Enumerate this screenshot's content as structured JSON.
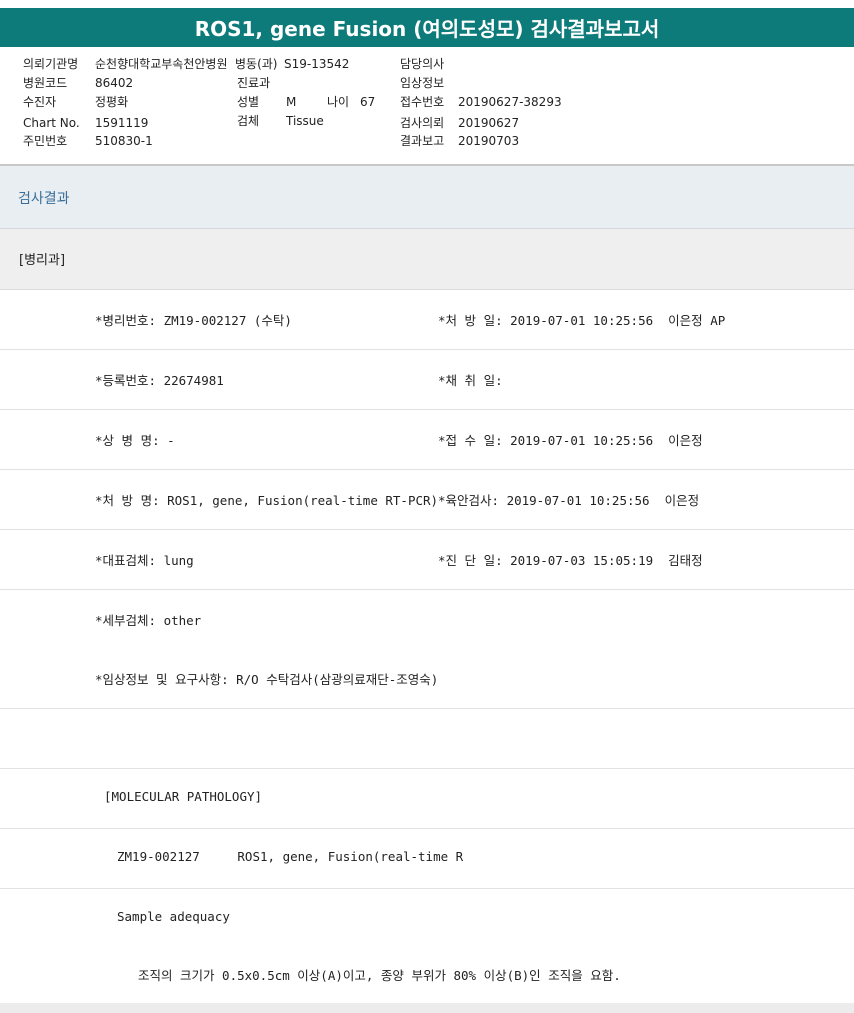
{
  "title": "ROS1, gene Fusion (여의도성모) 검사결과보고서",
  "header": {
    "req_org_label": "의뢰기관명",
    "req_org_value": "순천향대학교부속천안병원",
    "dept_label": "병동(과)",
    "dept_value": "S19-13542",
    "doctor_label": "담당의사",
    "hosp_code_label": "병원코드",
    "hosp_code_value": "86402",
    "clinic_label": "진료과",
    "clinical_info_label": "임상정보",
    "patient_label": "수진자",
    "patient_value": "정평화",
    "sex_label": "성별",
    "sex_value": "M",
    "age_label": "나이",
    "age_value": "67",
    "receipt_label": "접수번호",
    "receipt_value": "20190627-38293",
    "chart_label": "Chart No.",
    "chart_value": "1591119",
    "specimen_label": "검체",
    "specimen_value": "Tissue",
    "test_req_label": "검사의뢰",
    "test_req_value": "20190627",
    "rrn_label": "주민번호",
    "rrn_value": "510830-1",
    "report_label": "결과보고",
    "report_value": "20190703"
  },
  "section_title": "검사결과",
  "department": "[병리과]",
  "rows": [
    {
      "left": "*병리번호: ZM19-002127 (수탁)",
      "right": "*처 방 일: 2019-07-01 10:25:56  이은정 AP"
    },
    {
      "left": "*등록번호: 22674981",
      "right": "*채 취 일:"
    },
    {
      "left": "*상 병 명: -",
      "right": "*접 수 일: 2019-07-01 10:25:56  이은정"
    },
    {
      "left": "*처 방 명: ROS1, gene, Fusion(real-time RT-PCR)",
      "right": "*육안검사: 2019-07-01 10:25:56  이은정"
    },
    {
      "left": "*대표검체: lung",
      "right": "*진 단 일: 2019-07-03 15:05:19  김태정"
    },
    {
      "left": "*세부검체: other",
      "right": ""
    },
    {
      "left": "*임상정보 및 요구사항: R/O 수탁검사(삼광의료재단-조영숙)",
      "right": ""
    }
  ],
  "mol_path": "[MOLECULAR PATHOLOGY]",
  "mol_line": "ZM19-002127     ROS1, gene, Fusion(real-time R",
  "sample_adequacy": "Sample adequacy",
  "adequacy_note": "조직의 크기가 0.5x0.5cm 이상(A)이고, 종양 부위가 80% 이상(B)인 조직을 요함."
}
